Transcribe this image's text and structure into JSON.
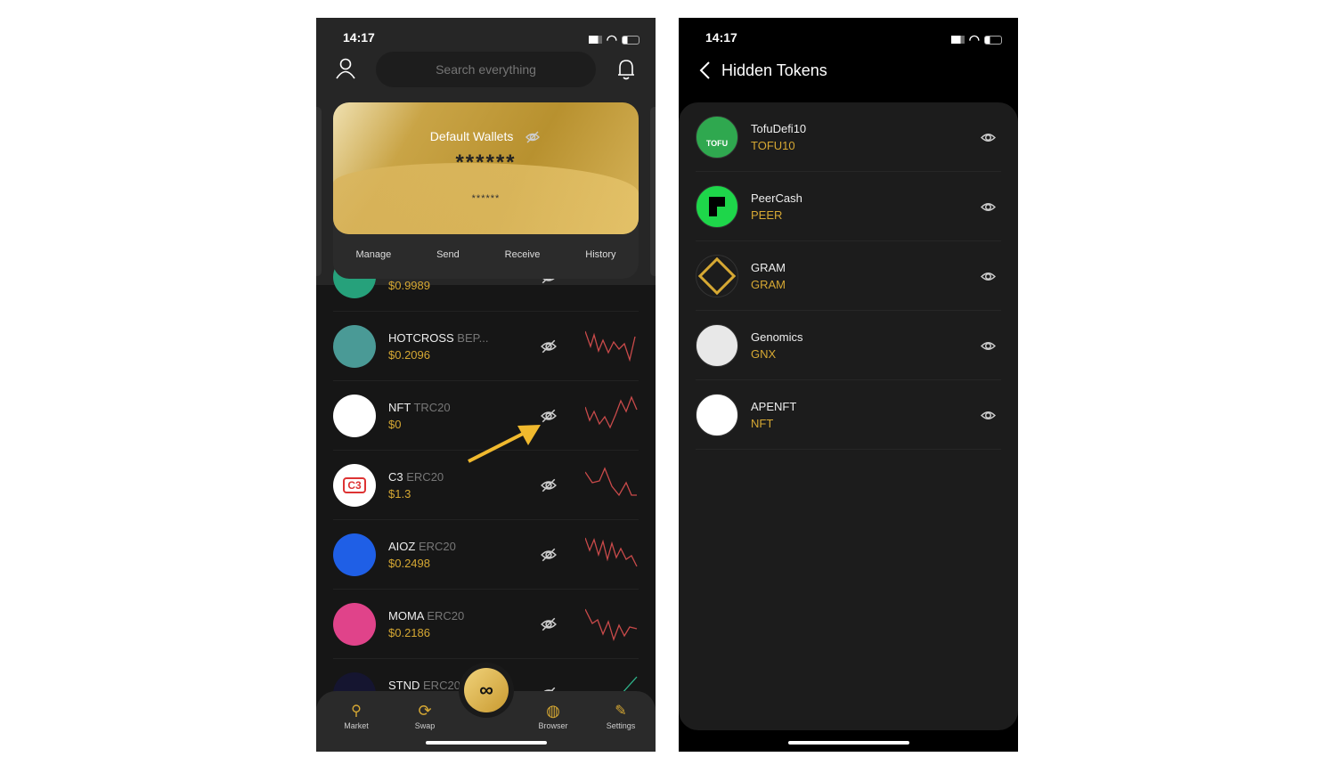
{
  "left": {
    "status": {
      "time": "14:17"
    },
    "search": {
      "placeholder": "Search everything"
    },
    "card": {
      "title": "Default Wallets",
      "balance": "******",
      "sub_balance": "******"
    },
    "actions": [
      "Manage",
      "Send",
      "Receive",
      "History"
    ],
    "tokens": [
      {
        "name": "",
        "standard": "",
        "price": "$0.9989",
        "color": "#26a17b"
      },
      {
        "name": "HOTCROSS",
        "standard": "BEP...",
        "price": "$0.2096",
        "color": "#4a9a96"
      },
      {
        "name": "NFT",
        "standard": "TRC20",
        "price": "$0",
        "color": "#ffffff"
      },
      {
        "name": "C3",
        "standard": "ERC20",
        "price": "$1.3",
        "color": "#ffffff"
      },
      {
        "name": "AIOZ",
        "standard": "ERC20",
        "price": "$0.2498",
        "color": "#1f5fe6"
      },
      {
        "name": "MOMA",
        "standard": "ERC20",
        "price": "$0.2186",
        "color": "#e0438a"
      },
      {
        "name": "STND",
        "standard": "ERC20",
        "price": "",
        "color": "#151530"
      }
    ],
    "logo_text": {
      "c3": "C3"
    },
    "nav": [
      {
        "label": "Market",
        "icon": "market-icon"
      },
      {
        "label": "Swap",
        "icon": "swap-icon"
      },
      {
        "label": "Browser",
        "icon": "globe-icon"
      },
      {
        "label": "Settings",
        "icon": "wrench-icon"
      }
    ],
    "accent": "#d6a833",
    "sparkline_color": "#c94a4a"
  },
  "right": {
    "status": {
      "time": "14:17"
    },
    "title": "Hidden Tokens",
    "tokens": [
      {
        "name": "TofuDefi10",
        "symbol": "TOFU10",
        "color": "#2fa84f",
        "logo_text": "TOFU"
      },
      {
        "name": "PeerCash",
        "symbol": "PEER",
        "color": "#1ed64a",
        "logo_text": ""
      },
      {
        "name": "GRAM",
        "symbol": "GRAM",
        "color": "#1c1c1c",
        "logo_text": ""
      },
      {
        "name": "Genomics",
        "symbol": "GNX",
        "color": "#e8e8e8",
        "logo_text": ""
      },
      {
        "name": "APENFT",
        "symbol": "NFT",
        "color": "#ffffff",
        "logo_text": ""
      }
    ]
  }
}
